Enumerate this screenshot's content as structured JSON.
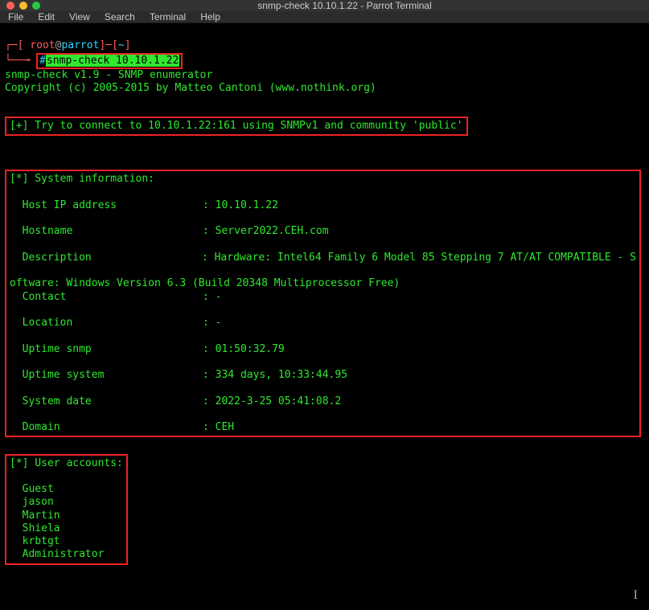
{
  "window": {
    "title": "snmp-check 10.10.1.22 - Parrot Terminal"
  },
  "menu": {
    "file": "File",
    "edit": "Edit",
    "view": "View",
    "search": "Search",
    "terminal": "Terminal",
    "help": "Help"
  },
  "prompt": {
    "open": "┌─[",
    "user": " root",
    "at": "@",
    "host": "parrot",
    "close": "]─[",
    "tilde": "~",
    "close2": "]",
    "line2_prefix": "└──╼ ",
    "hash": "#",
    "command": "snmp-check 10.10.1.22"
  },
  "header": {
    "line1": "snmp-check v1.9 - SNMP enumerator",
    "line2": "Copyright (c) 2005-2015 by Matteo Cantoni (www.nothink.org)"
  },
  "connect": {
    "text": "[+] Try to connect to 10.10.1.22:161 using SNMPv1 and community 'public'"
  },
  "sysinfo": {
    "heading": "[*] System information:",
    "rows": {
      "host_ip_k": "  Host IP address",
      "host_ip_v": "10.10.1.22",
      "hostname_k": "  Hostname",
      "hostname_v": "Server2022.CEH.com",
      "desc_k": "  Description",
      "desc_v": "Hardware: Intel64 Family 6 Model 85 Stepping 7 AT/AT COMPATIBLE - S",
      "desc_wrap": "oftware: Windows Version 6.3 (Build 20348 Multiprocessor Free)",
      "contact_k": "  Contact",
      "contact_v": "-",
      "location_k": "  Location",
      "location_v": "-",
      "up_snmp_k": "  Uptime snmp",
      "up_snmp_v": "01:50:32.79",
      "up_sys_k": "  Uptime system",
      "up_sys_v": "334 days, 10:33:44.95",
      "sysdate_k": "  System date",
      "sysdate_v": "2022-3-25 05:41:08.2",
      "domain_k": "  Domain",
      "domain_v": "CEH"
    }
  },
  "users": {
    "heading": "[*] User accounts:",
    "list": [
      "  Guest",
      "  jason",
      "  Martin",
      "  Shiela",
      "  krbtgt",
      "  Administrator"
    ]
  }
}
